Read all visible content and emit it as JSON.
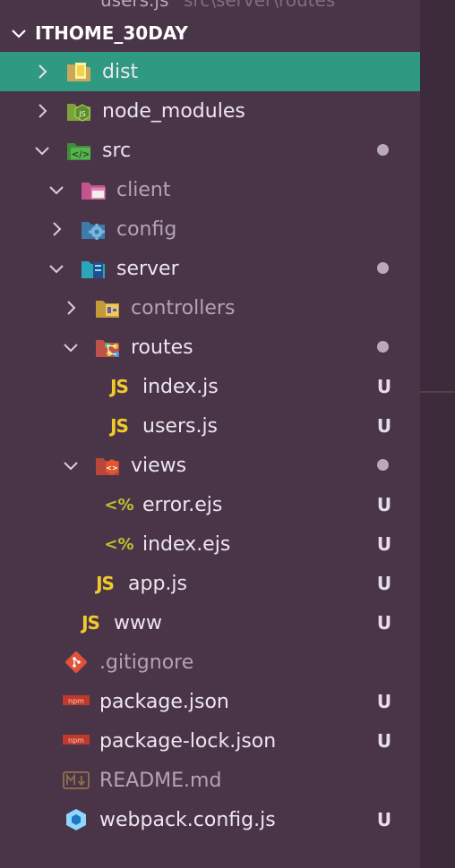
{
  "top_strip": {
    "file": "users.js",
    "path": "src\\server\\routes"
  },
  "explorer": {
    "title": "ITHOME_30DAY",
    "items": [
      {
        "label": "dist",
        "status": ""
      },
      {
        "label": "node_modules",
        "status": ""
      },
      {
        "label": "src",
        "status": ""
      },
      {
        "label": "client",
        "status": ""
      },
      {
        "label": "config",
        "status": ""
      },
      {
        "label": "server",
        "status": ""
      },
      {
        "label": "controllers",
        "status": ""
      },
      {
        "label": "routes",
        "status": ""
      },
      {
        "label": "index.js",
        "status": "U",
        "icon_text": "JS"
      },
      {
        "label": "users.js",
        "status": "U",
        "icon_text": "JS"
      },
      {
        "label": "views",
        "status": ""
      },
      {
        "label": "error.ejs",
        "status": "U",
        "icon_text": "<%"
      },
      {
        "label": "index.ejs",
        "status": "U",
        "icon_text": "<%"
      },
      {
        "label": "app.js",
        "status": "U",
        "icon_text": "JS"
      },
      {
        "label": "www",
        "status": "U",
        "icon_text": "JS"
      },
      {
        "label": ".gitignore",
        "status": ""
      },
      {
        "label": "package.json",
        "status": "U"
      },
      {
        "label": "package-lock.json",
        "status": "U"
      },
      {
        "label": "README.md",
        "status": ""
      },
      {
        "label": "webpack.config.js",
        "status": "U"
      }
    ]
  },
  "colors": {
    "sidebar_bg": "#4a3448",
    "selected_bg": "#2f9982",
    "js_icon": "#f0cc2a",
    "ejs_icon": "#b9c52f",
    "modified_dot": "#b9aab7"
  }
}
